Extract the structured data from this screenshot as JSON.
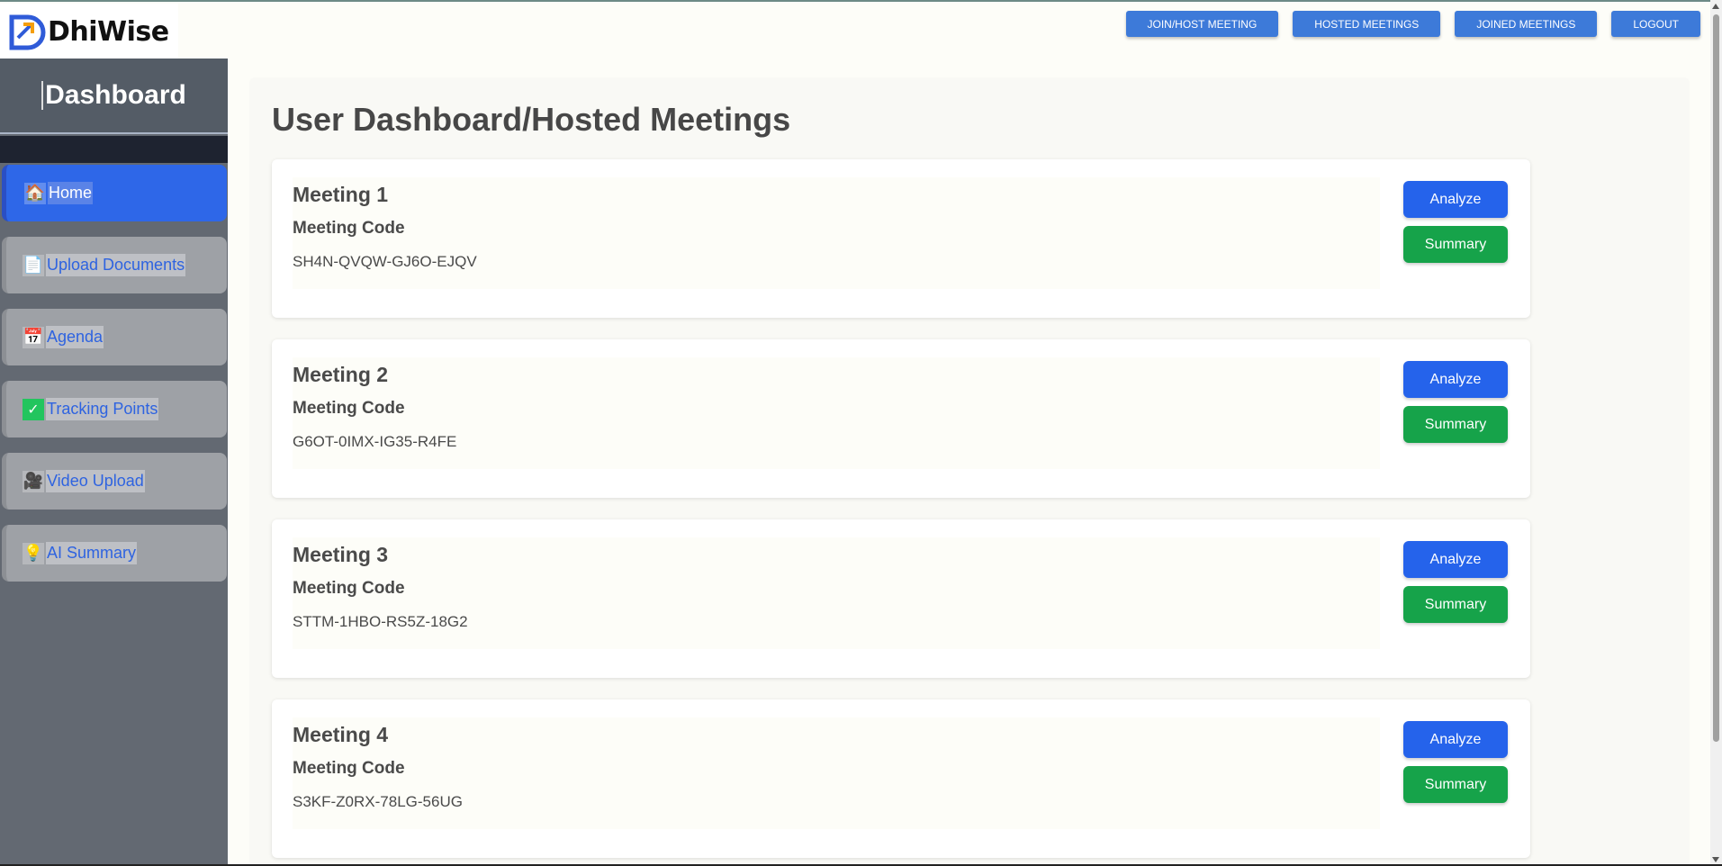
{
  "brand": {
    "name": "DhiWise"
  },
  "topnav": [
    {
      "label": "JOIN/HOST MEETING"
    },
    {
      "label": "HOSTED MEETINGS"
    },
    {
      "label": "JOINED MEETINGS"
    },
    {
      "label": "LOGOUT"
    }
  ],
  "sidebar": {
    "title": "Dashboard",
    "items": [
      {
        "label": "Home",
        "icon": "house-icon",
        "active": true
      },
      {
        "label": "Upload Documents",
        "icon": "document-icon"
      },
      {
        "label": "Agenda",
        "icon": "calendar-icon"
      },
      {
        "label": "Tracking Points",
        "icon": "checkmark-icon"
      },
      {
        "label": "Video Upload",
        "icon": "video-camera-icon"
      },
      {
        "label": "AI Summary",
        "icon": "lightbulb-icon"
      }
    ]
  },
  "main": {
    "title": "User Dashboard/Hosted Meetings",
    "meetings": [
      {
        "title": "Meeting 1",
        "code_label": "Meeting Code",
        "code": "SH4N-QVQW-GJ6O-EJQV",
        "analyze_label": "Analyze",
        "summary_label": "Summary"
      },
      {
        "title": "Meeting 2",
        "code_label": "Meeting Code",
        "code": "G6OT-0IMX-IG35-R4FE",
        "analyze_label": "Analyze",
        "summary_label": "Summary"
      },
      {
        "title": "Meeting 3",
        "code_label": "Meeting Code",
        "code": "STTM-1HBO-RS5Z-18G2",
        "analyze_label": "Analyze",
        "summary_label": "Summary"
      },
      {
        "title": "Meeting 4",
        "code_label": "Meeting Code",
        "code": "S3KF-Z0RX-78LG-56UG",
        "analyze_label": "Analyze",
        "summary_label": "Summary"
      }
    ]
  },
  "colors": {
    "analyze": "#2563eb",
    "summary": "#16a34a",
    "topnav": "#3d7ad9",
    "sidebar_active": "#2e67e8"
  }
}
